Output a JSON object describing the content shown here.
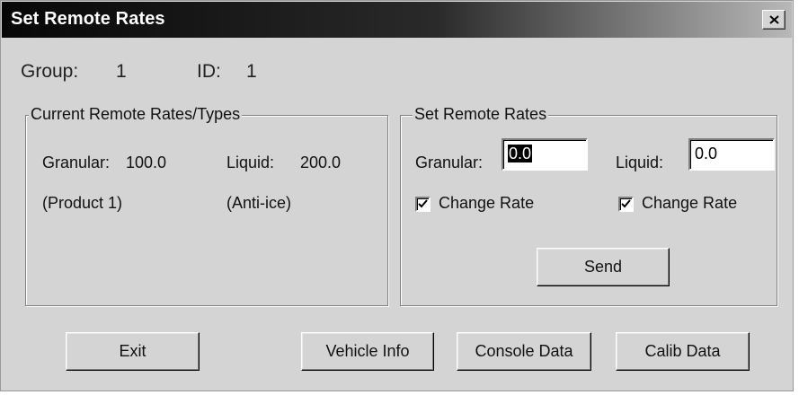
{
  "window": {
    "title": "Set Remote Rates"
  },
  "header": {
    "group_label": "Group:",
    "group_value": "1",
    "id_label": "ID:",
    "id_value": "1"
  },
  "current_rates": {
    "legend": "Current Remote Rates/Types",
    "granular_label": "Granular:",
    "granular_value": "100.0",
    "liquid_label": "Liquid:",
    "liquid_value": "200.0",
    "granular_type": "(Product 1)",
    "liquid_type": "(Anti-ice)"
  },
  "set_rates": {
    "legend": "Set Remote Rates",
    "granular_label": "Granular:",
    "granular_input": "0.0",
    "liquid_label": "Liquid:",
    "liquid_input": "0.0",
    "granular_change_label": "Change Rate",
    "granular_change_checked": true,
    "liquid_change_label": "Change Rate",
    "liquid_change_checked": true,
    "send_label": "Send"
  },
  "buttons": {
    "exit": "Exit",
    "vehicle_info": "Vehicle Info",
    "console_data": "Console Data",
    "calib_data": "Calib Data"
  }
}
